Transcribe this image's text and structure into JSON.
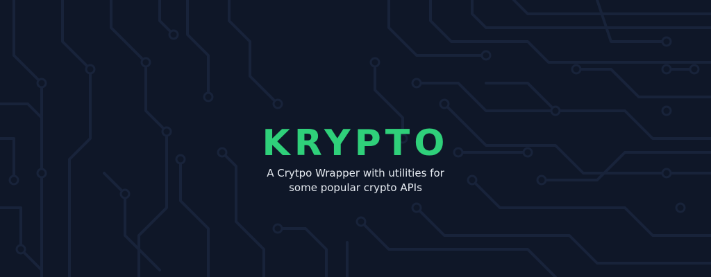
{
  "brand": {
    "name": "KRYPTO",
    "tagline": "A Crytpo Wrapper with utilities for\nsome popular crypto APIs",
    "accent_color": "#2fd07a",
    "background_color": "#0f1728",
    "pattern_color": "#18233a",
    "text_color": "#e6ebf2"
  },
  "decor": {
    "pattern": "circuit-board-icon"
  }
}
